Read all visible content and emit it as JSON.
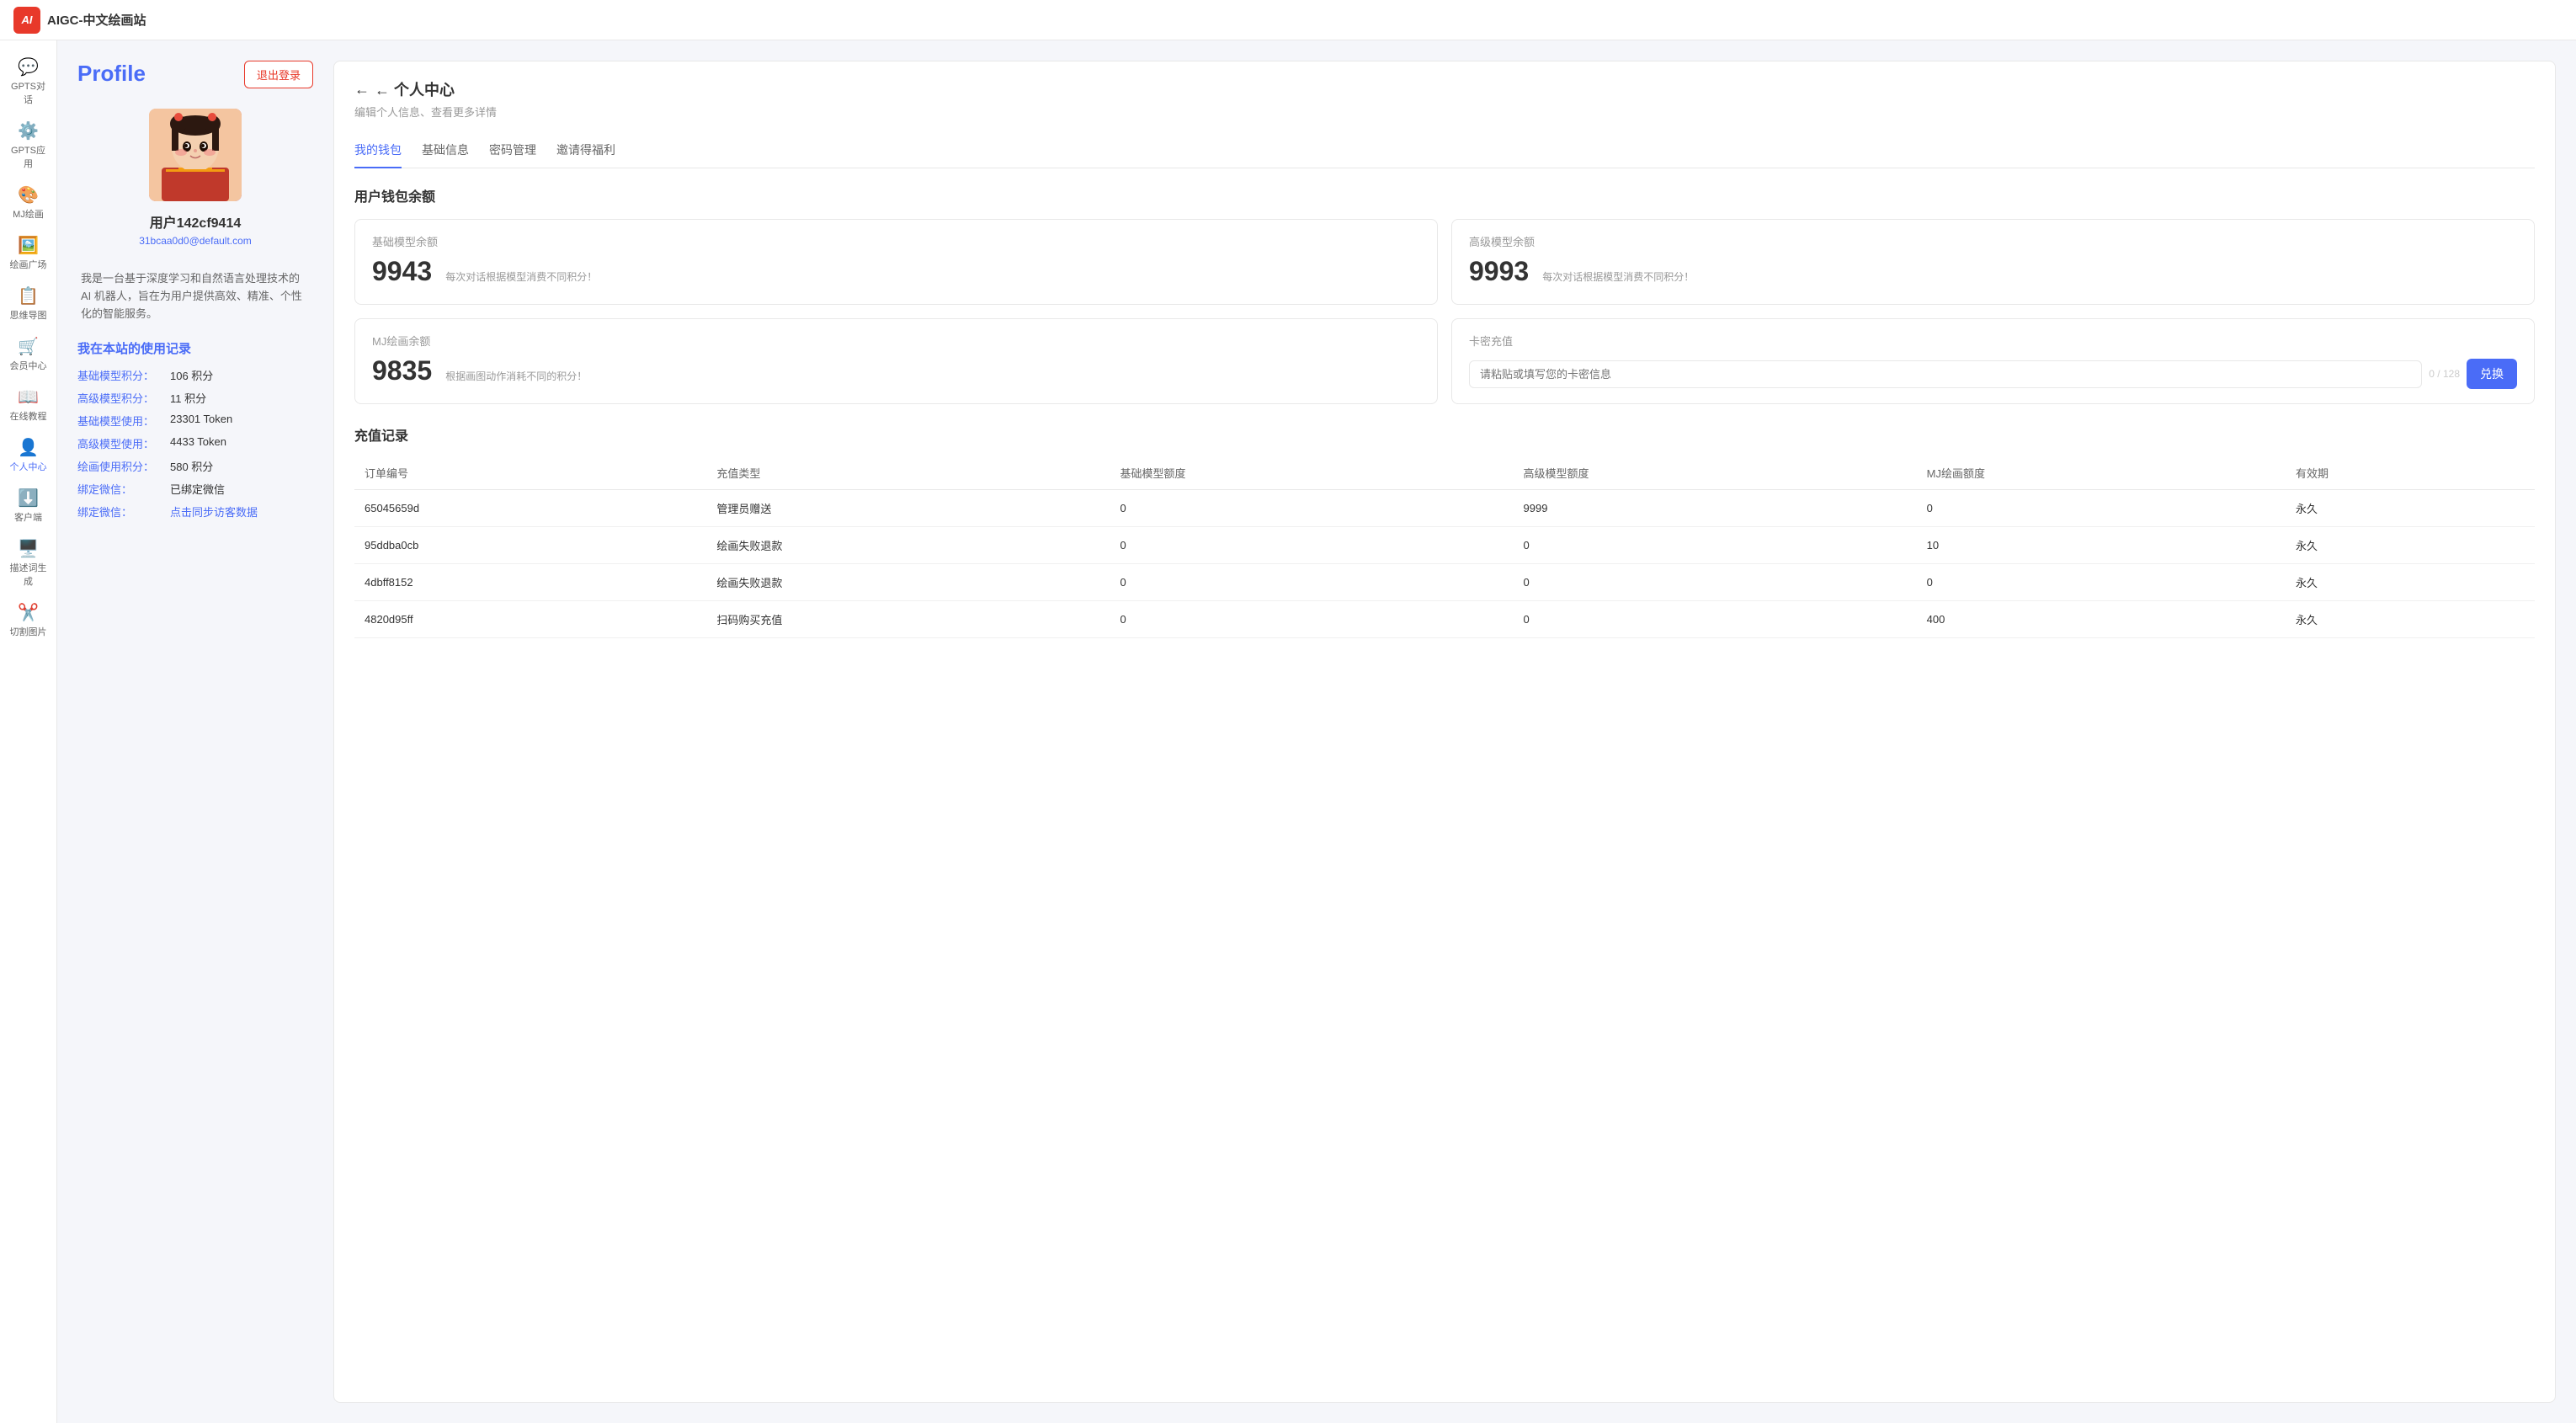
{
  "app": {
    "title": "AIGC-中文绘画站",
    "logo_text": "AI"
  },
  "sidebar": {
    "items": [
      {
        "id": "gpts-chat",
        "label": "GPTS对话",
        "icon": "💬",
        "active": false
      },
      {
        "id": "gpts-apps",
        "label": "GPTS应用",
        "icon": "⚙️",
        "active": false
      },
      {
        "id": "mj-draw",
        "label": "MJ绘画",
        "icon": "🎨",
        "active": false
      },
      {
        "id": "gallery",
        "label": "绘画广场",
        "icon": "🖼️",
        "active": false
      },
      {
        "id": "mindmap",
        "label": "思维导图",
        "icon": "📋",
        "active": false
      },
      {
        "id": "member",
        "label": "会员中心",
        "icon": "🛒",
        "active": false
      },
      {
        "id": "tutorials",
        "label": "在线教程",
        "icon": "📖",
        "active": false
      },
      {
        "id": "personal",
        "label": "个人中心",
        "icon": "👤",
        "active": true
      },
      {
        "id": "client",
        "label": "客户端",
        "icon": "⬇️",
        "active": false
      },
      {
        "id": "prompt-gen",
        "label": "描述词生成",
        "icon": "🖥️",
        "active": false
      },
      {
        "id": "cut-image",
        "label": "切割图片",
        "icon": "✂️",
        "active": false
      }
    ]
  },
  "profile": {
    "title": "Profile",
    "logout_label": "退出登录",
    "username": "用户142cf9414",
    "email": "31bcaa0d0@default.com",
    "bio": "我是一台基于深度学习和自然语言处理技术的 AI 机器人，旨在为用户提供高效、精准、个性化的智能服务。",
    "usage_title": "我在本站的使用记录",
    "usage_rows": [
      {
        "label": "基础模型积分：",
        "value": "106 积分"
      },
      {
        "label": "高级模型积分：",
        "value": "11 积分"
      },
      {
        "label": "基础模型使用：",
        "value": "23301 Token"
      },
      {
        "label": "高级模型使用：",
        "value": "4433 Token"
      },
      {
        "label": "绘画使用积分：",
        "value": "580 积分"
      },
      {
        "label": "绑定微信：",
        "value": "已绑定微信"
      },
      {
        "label": "绑定微信：",
        "value": "点击同步访客数据"
      }
    ]
  },
  "personal_center": {
    "back_label": "← 个人中心",
    "subtitle": "编辑个人信息、查看更多详情",
    "tabs": [
      {
        "id": "wallet",
        "label": "我的钱包",
        "active": true
      },
      {
        "id": "basic-info",
        "label": "基础信息",
        "active": false
      },
      {
        "id": "password",
        "label": "密码管理",
        "active": false
      },
      {
        "id": "invite",
        "label": "邀请得福利",
        "active": false
      }
    ],
    "wallet_title": "用户钱包余额",
    "wallet_cards": [
      {
        "id": "basic-model",
        "title": "基础模型余额",
        "amount": "9943",
        "desc": "每次对话根据模型消费不同积分！"
      },
      {
        "id": "advanced-model",
        "title": "高级模型余额",
        "amount": "9993",
        "desc": "每次对话根据模型消费不同积分！"
      },
      {
        "id": "mj-draw",
        "title": "MJ绘画余额",
        "amount": "9835",
        "desc": "根据画图动作消耗不同的积分！"
      },
      {
        "id": "card-redeem",
        "title": "卡密充值",
        "input_placeholder": "请粘贴或填写您的卡密信息",
        "counter": "0 / 128",
        "redeem_label": "兑换"
      }
    ],
    "records_title": "充值记录",
    "table_headers": [
      "订单编号",
      "充值类型",
      "基础模型额度",
      "高级模型额度",
      "MJ绘画额度",
      "有效期"
    ],
    "table_rows": [
      {
        "order": "65045659d",
        "type": "管理员赠送",
        "basic": "0",
        "advanced": "9999",
        "mj": "0",
        "validity": "永久"
      },
      {
        "order": "95ddba0cb",
        "type": "绘画失败退款",
        "basic": "0",
        "advanced": "0",
        "mj": "10",
        "validity": "永久"
      },
      {
        "order": "4dbff8152",
        "type": "绘画失败退款",
        "basic": "0",
        "advanced": "0",
        "mj": "0",
        "validity": "永久"
      },
      {
        "order": "4820d95ff",
        "type": "扫码购买充值",
        "basic": "0",
        "advanced": "0",
        "mj": "400",
        "validity": "永久"
      }
    ]
  },
  "colors": {
    "accent": "#4a6cf7",
    "danger": "#e8392a",
    "text_primary": "#333",
    "text_secondary": "#666",
    "text_muted": "#999"
  }
}
